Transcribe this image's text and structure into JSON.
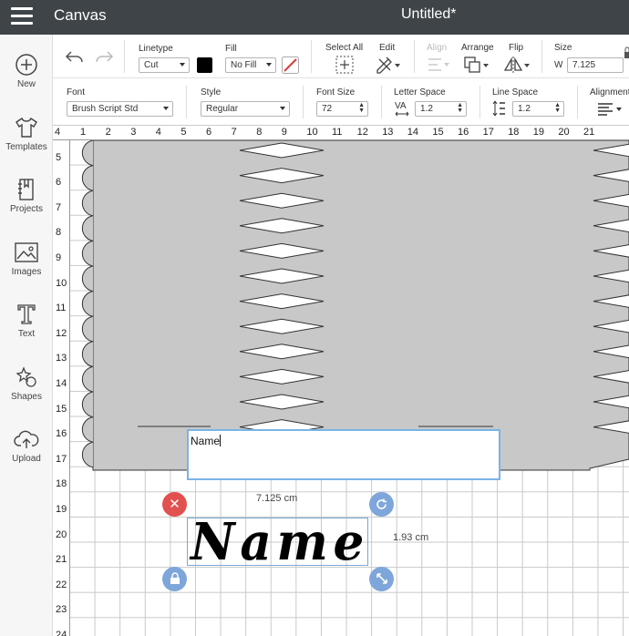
{
  "topbar": {
    "app_title": "Canvas",
    "doc_title": "Untitled*",
    "menu_icon": "hamburger-icon"
  },
  "sidebar": {
    "items": [
      {
        "label": "New",
        "icon": "plus-circle-icon"
      },
      {
        "label": "Templates",
        "icon": "tshirt-icon"
      },
      {
        "label": "Projects",
        "icon": "notebook-icon"
      },
      {
        "label": "Images",
        "icon": "image-icon"
      },
      {
        "label": "Text",
        "icon": "text-t-icon"
      },
      {
        "label": "Shapes",
        "icon": "shapes-icon"
      },
      {
        "label": "Upload",
        "icon": "cloud-upload-icon"
      }
    ]
  },
  "toolbar": {
    "linetype_label": "Linetype",
    "linetype_value": "Cut",
    "fill_label": "Fill",
    "fill_value": "No Fill",
    "select_all_label": "Select All",
    "edit_label": "Edit",
    "align_label": "Align",
    "arrange_label": "Arrange",
    "flip_label": "Flip",
    "size_label": "Size",
    "size_w_label": "W",
    "size_w_value": "7.125",
    "colors": {
      "linetype_swatch": "#000000",
      "fill_slash": "#e03a3a"
    }
  },
  "text_toolbar": {
    "font_label": "Font",
    "font_value": "Brush Script Std",
    "style_label": "Style",
    "style_value": "Regular",
    "font_size_label": "Font Size",
    "font_size_value": "72",
    "letter_space_label": "Letter Space",
    "letter_space_icon_text": "VA",
    "letter_space_value": "1.2",
    "line_space_label": "Line Space",
    "line_space_value": "1.2",
    "alignment_label": "Alignment"
  },
  "ruler": {
    "h": [
      "4",
      "1",
      "2",
      "3",
      "4",
      "5",
      "6",
      "7",
      "8",
      "9",
      "10",
      "11",
      "12",
      "13",
      "14",
      "15",
      "16",
      "17",
      "18",
      "19",
      "20",
      "21"
    ],
    "v": [
      "4",
      "5",
      "6",
      "7",
      "8",
      "9",
      "10",
      "11",
      "12",
      "13",
      "14",
      "15",
      "16",
      "17",
      "18",
      "19",
      "20",
      "21",
      "22",
      "23",
      "24"
    ]
  },
  "canvas": {
    "text_input_value": "Name",
    "artwork_text": "Name",
    "width_readout": "7.125 cm",
    "height_readout": "1.93 cm",
    "colors": {
      "shape_fill": "#c8c8c8",
      "selection": "#7ab3e8",
      "delete_handle": "#e0514f",
      "action_handle": "#7ea6db"
    }
  }
}
